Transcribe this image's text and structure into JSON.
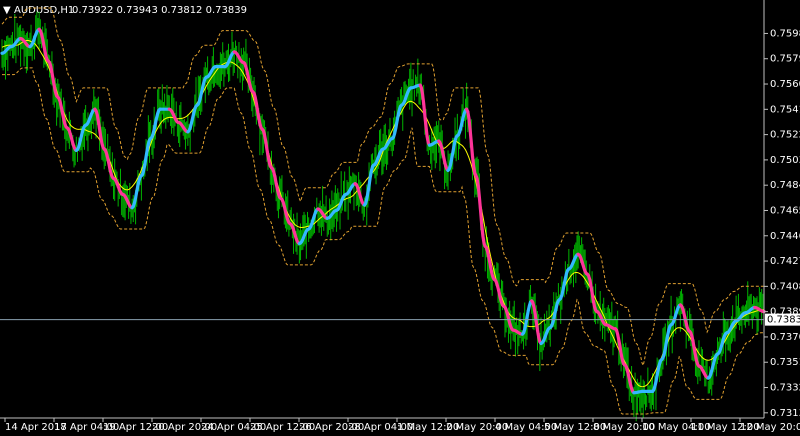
{
  "header": {
    "symbol_label": "AUDUSD,H1",
    "ohlc": "0.73922 0.73943 0.73812 0.73839"
  },
  "colors": {
    "background": "#000000",
    "axis": "#c0c0c0",
    "text": "#ffffff",
    "bars": "#00b400",
    "ma_fast": "#ffff00",
    "band": "#e0a030",
    "trend_up": "#33b8ff",
    "trend_down": "#ff3399",
    "price_line": "#8aa0b0"
  },
  "chart_data": {
    "type": "line",
    "title": "AUDUSD,H1",
    "ylim": [
      0.731,
      0.7609
    ],
    "y_ticks": [
      "0.75989",
      "0.75799",
      "0.75609",
      "0.75419",
      "0.75229",
      "0.75039",
      "0.74849",
      "0.74659",
      "0.74469",
      "0.74279",
      "0.74089",
      "0.73899",
      "0.73709",
      "0.73519",
      "0.73329",
      "0.73139"
    ],
    "current_price": "0.73839",
    "x_ticks": [
      "14 Apr 2017",
      "18 Apr 04:00",
      "19 Apr 12:00",
      "20 Apr 20:00",
      "24 Apr 04:00",
      "25 Apr 12:00",
      "26 Apr 20:00",
      "28 Apr 04:00",
      "1 May 12:00",
      "2 May 20:00",
      "4 May 04:00",
      "5 May 12:00",
      "8 May 20:00",
      "10 May 04:00",
      "11 May 12:00",
      "12 May 20:00"
    ],
    "series": [
      {
        "values": [
          0.7584,
          0.7589,
          0.7595,
          0.7589,
          0.7602,
          0.7578,
          0.7551,
          0.7528,
          0.7511,
          0.753,
          0.7542,
          0.7512,
          0.749,
          0.7478,
          0.7468,
          0.7492,
          0.752,
          0.7542,
          0.7542,
          0.7532,
          0.7525,
          0.7545,
          0.7566,
          0.7574,
          0.7574,
          0.7585,
          0.7577,
          0.7555,
          0.7527,
          0.7498,
          0.7475,
          0.7456,
          0.7441,
          0.7452,
          0.7467,
          0.746,
          0.7466,
          0.7478,
          0.7486,
          0.747,
          0.75,
          0.7512,
          0.752,
          0.7545,
          0.7558,
          0.756,
          0.7515,
          0.7518,
          0.7496,
          0.7522,
          0.7542,
          0.7492,
          0.7439,
          0.7414,
          0.7394,
          0.7376,
          0.7373,
          0.7398,
          0.7366,
          0.7378,
          0.7399,
          0.7422,
          0.7433,
          0.7418,
          0.739,
          0.738,
          0.7377,
          0.735,
          0.7329,
          0.733,
          0.733,
          0.7354,
          0.738,
          0.7395,
          0.7375,
          0.7349,
          0.734,
          0.7358,
          0.7374,
          0.7383,
          0.7389,
          0.7393,
          0.739
        ]
      }
    ]
  }
}
